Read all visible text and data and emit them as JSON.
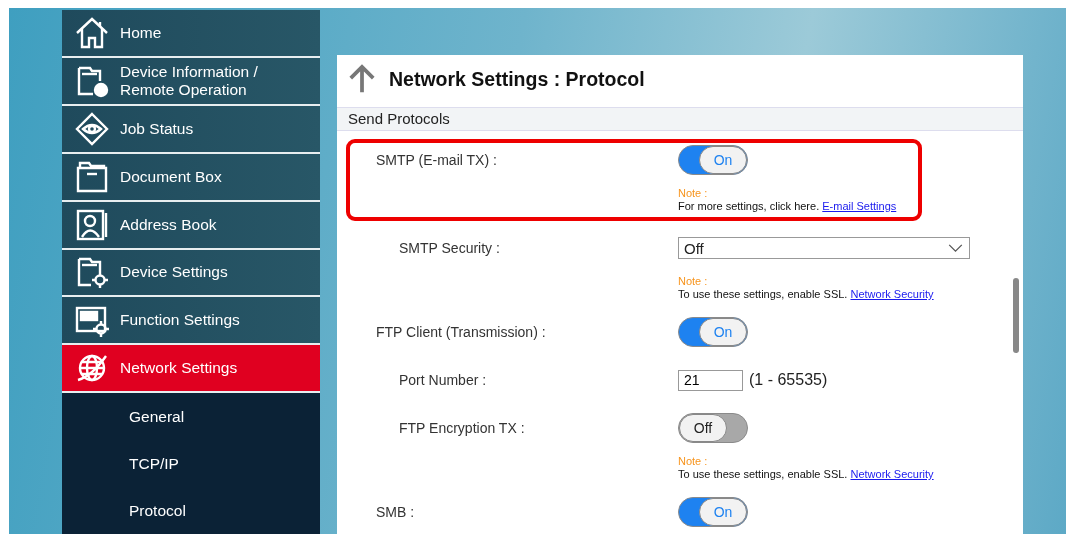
{
  "sidebar": {
    "items": [
      {
        "label": "Home",
        "selected": false
      },
      {
        "label": "Device Information /\nRemote Operation",
        "selected": false
      },
      {
        "label": "Job Status",
        "selected": false
      },
      {
        "label": "Document Box",
        "selected": false
      },
      {
        "label": "Address Book",
        "selected": false
      },
      {
        "label": "Device Settings",
        "selected": false
      },
      {
        "label": "Function Settings",
        "selected": false
      },
      {
        "label": "Network Settings",
        "selected": true,
        "children": [
          {
            "label": "General"
          },
          {
            "label": "TCP/IP"
          },
          {
            "label": "Protocol"
          }
        ]
      }
    ]
  },
  "page": {
    "title": "Network Settings : Protocol",
    "section": "Send Protocols",
    "settings": [
      {
        "kind": "toggle",
        "label": "SMTP (E-mail TX) :",
        "indented": false,
        "highlighted": true,
        "on": true,
        "value": "On",
        "note": {
          "label": "Note :",
          "text": "For more settings, click here.",
          "link": "E-mail Settings"
        }
      },
      {
        "kind": "select",
        "label": "SMTP Security :",
        "indented": true,
        "highlighted": false,
        "value": "Off",
        "note": {
          "label": "Note :",
          "text": "To use these settings, enable SSL.",
          "link": "Network Security"
        }
      },
      {
        "kind": "toggle",
        "label": "FTP Client (Transmission) :",
        "indented": false,
        "highlighted": false,
        "on": true,
        "value": "On"
      },
      {
        "kind": "number",
        "label": "Port Number :",
        "indented": true,
        "highlighted": false,
        "value": "21",
        "range": "(1 - 65535)"
      },
      {
        "kind": "toggle",
        "label": "FTP Encryption TX :",
        "indented": true,
        "highlighted": false,
        "on": false,
        "value": "Off",
        "note": {
          "label": "Note :",
          "text": "To use these settings, enable SSL.",
          "link": "Network Security"
        }
      },
      {
        "kind": "toggle",
        "label": "SMB :",
        "indented": false,
        "highlighted": false,
        "on": true,
        "value": "On"
      }
    ]
  }
}
